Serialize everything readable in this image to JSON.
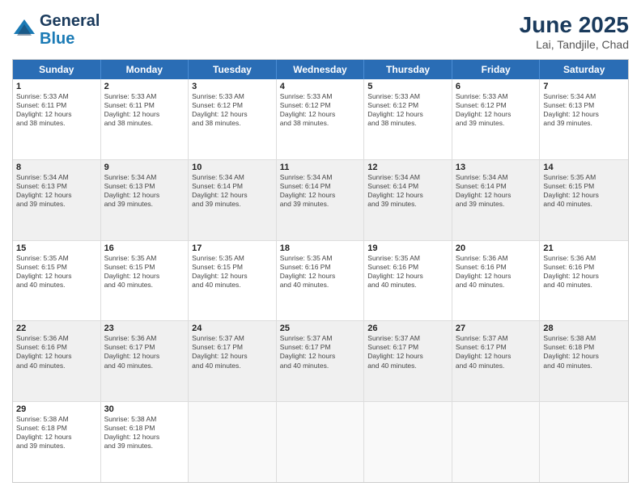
{
  "header": {
    "logo_line1": "General",
    "logo_line2": "Blue",
    "title": "June 2025",
    "subtitle": "Lai, Tandjile, Chad"
  },
  "days_of_week": [
    "Sunday",
    "Monday",
    "Tuesday",
    "Wednesday",
    "Thursday",
    "Friday",
    "Saturday"
  ],
  "rows": [
    [
      {
        "day": "1",
        "lines": [
          "Sunrise: 5:33 AM",
          "Sunset: 6:11 PM",
          "Daylight: 12 hours",
          "and 38 minutes."
        ]
      },
      {
        "day": "2",
        "lines": [
          "Sunrise: 5:33 AM",
          "Sunset: 6:11 PM",
          "Daylight: 12 hours",
          "and 38 minutes."
        ]
      },
      {
        "day": "3",
        "lines": [
          "Sunrise: 5:33 AM",
          "Sunset: 6:12 PM",
          "Daylight: 12 hours",
          "and 38 minutes."
        ]
      },
      {
        "day": "4",
        "lines": [
          "Sunrise: 5:33 AM",
          "Sunset: 6:12 PM",
          "Daylight: 12 hours",
          "and 38 minutes."
        ]
      },
      {
        "day": "5",
        "lines": [
          "Sunrise: 5:33 AM",
          "Sunset: 6:12 PM",
          "Daylight: 12 hours",
          "and 38 minutes."
        ]
      },
      {
        "day": "6",
        "lines": [
          "Sunrise: 5:33 AM",
          "Sunset: 6:12 PM",
          "Daylight: 12 hours",
          "and 39 minutes."
        ]
      },
      {
        "day": "7",
        "lines": [
          "Sunrise: 5:34 AM",
          "Sunset: 6:13 PM",
          "Daylight: 12 hours",
          "and 39 minutes."
        ]
      }
    ],
    [
      {
        "day": "8",
        "lines": [
          "Sunrise: 5:34 AM",
          "Sunset: 6:13 PM",
          "Daylight: 12 hours",
          "and 39 minutes."
        ]
      },
      {
        "day": "9",
        "lines": [
          "Sunrise: 5:34 AM",
          "Sunset: 6:13 PM",
          "Daylight: 12 hours",
          "and 39 minutes."
        ]
      },
      {
        "day": "10",
        "lines": [
          "Sunrise: 5:34 AM",
          "Sunset: 6:14 PM",
          "Daylight: 12 hours",
          "and 39 minutes."
        ]
      },
      {
        "day": "11",
        "lines": [
          "Sunrise: 5:34 AM",
          "Sunset: 6:14 PM",
          "Daylight: 12 hours",
          "and 39 minutes."
        ]
      },
      {
        "day": "12",
        "lines": [
          "Sunrise: 5:34 AM",
          "Sunset: 6:14 PM",
          "Daylight: 12 hours",
          "and 39 minutes."
        ]
      },
      {
        "day": "13",
        "lines": [
          "Sunrise: 5:34 AM",
          "Sunset: 6:14 PM",
          "Daylight: 12 hours",
          "and 39 minutes."
        ]
      },
      {
        "day": "14",
        "lines": [
          "Sunrise: 5:35 AM",
          "Sunset: 6:15 PM",
          "Daylight: 12 hours",
          "and 40 minutes."
        ]
      }
    ],
    [
      {
        "day": "15",
        "lines": [
          "Sunrise: 5:35 AM",
          "Sunset: 6:15 PM",
          "Daylight: 12 hours",
          "and 40 minutes."
        ]
      },
      {
        "day": "16",
        "lines": [
          "Sunrise: 5:35 AM",
          "Sunset: 6:15 PM",
          "Daylight: 12 hours",
          "and 40 minutes."
        ]
      },
      {
        "day": "17",
        "lines": [
          "Sunrise: 5:35 AM",
          "Sunset: 6:15 PM",
          "Daylight: 12 hours",
          "and 40 minutes."
        ]
      },
      {
        "day": "18",
        "lines": [
          "Sunrise: 5:35 AM",
          "Sunset: 6:16 PM",
          "Daylight: 12 hours",
          "and 40 minutes."
        ]
      },
      {
        "day": "19",
        "lines": [
          "Sunrise: 5:35 AM",
          "Sunset: 6:16 PM",
          "Daylight: 12 hours",
          "and 40 minutes."
        ]
      },
      {
        "day": "20",
        "lines": [
          "Sunrise: 5:36 AM",
          "Sunset: 6:16 PM",
          "Daylight: 12 hours",
          "and 40 minutes."
        ]
      },
      {
        "day": "21",
        "lines": [
          "Sunrise: 5:36 AM",
          "Sunset: 6:16 PM",
          "Daylight: 12 hours",
          "and 40 minutes."
        ]
      }
    ],
    [
      {
        "day": "22",
        "lines": [
          "Sunrise: 5:36 AM",
          "Sunset: 6:16 PM",
          "Daylight: 12 hours",
          "and 40 minutes."
        ]
      },
      {
        "day": "23",
        "lines": [
          "Sunrise: 5:36 AM",
          "Sunset: 6:17 PM",
          "Daylight: 12 hours",
          "and 40 minutes."
        ]
      },
      {
        "day": "24",
        "lines": [
          "Sunrise: 5:37 AM",
          "Sunset: 6:17 PM",
          "Daylight: 12 hours",
          "and 40 minutes."
        ]
      },
      {
        "day": "25",
        "lines": [
          "Sunrise: 5:37 AM",
          "Sunset: 6:17 PM",
          "Daylight: 12 hours",
          "and 40 minutes."
        ]
      },
      {
        "day": "26",
        "lines": [
          "Sunrise: 5:37 AM",
          "Sunset: 6:17 PM",
          "Daylight: 12 hours",
          "and 40 minutes."
        ]
      },
      {
        "day": "27",
        "lines": [
          "Sunrise: 5:37 AM",
          "Sunset: 6:17 PM",
          "Daylight: 12 hours",
          "and 40 minutes."
        ]
      },
      {
        "day": "28",
        "lines": [
          "Sunrise: 5:38 AM",
          "Sunset: 6:18 PM",
          "Daylight: 12 hours",
          "and 40 minutes."
        ]
      }
    ],
    [
      {
        "day": "29",
        "lines": [
          "Sunrise: 5:38 AM",
          "Sunset: 6:18 PM",
          "Daylight: 12 hours",
          "and 39 minutes."
        ]
      },
      {
        "day": "30",
        "lines": [
          "Sunrise: 5:38 AM",
          "Sunset: 6:18 PM",
          "Daylight: 12 hours",
          "and 39 minutes."
        ]
      },
      {
        "day": "",
        "lines": []
      },
      {
        "day": "",
        "lines": []
      },
      {
        "day": "",
        "lines": []
      },
      {
        "day": "",
        "lines": []
      },
      {
        "day": "",
        "lines": []
      }
    ]
  ]
}
